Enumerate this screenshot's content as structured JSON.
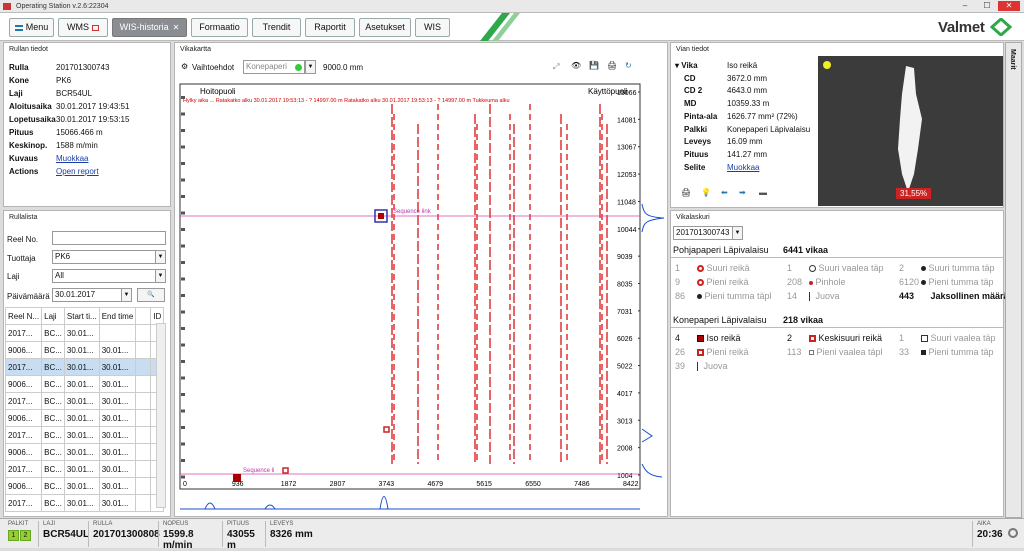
{
  "window": {
    "title": "Operating Station v.2.6:22304"
  },
  "tabs": [
    {
      "label": "Menu"
    },
    {
      "label": "WMS"
    },
    {
      "label": "WIS-historia"
    },
    {
      "label": "Formaatio"
    },
    {
      "label": "Trendit"
    },
    {
      "label": "Raportit"
    },
    {
      "label": "Asetukset"
    },
    {
      "label": "WIS"
    }
  ],
  "brand": {
    "name": "Valmet",
    "color": "#2ea84a"
  },
  "rullan_tiedot": {
    "title": "Rullan tiedot",
    "rows": [
      {
        "k": "Rulla",
        "v": "201701300743"
      },
      {
        "k": "Kone",
        "v": "PK6"
      },
      {
        "k": "Laji",
        "v": "BCR54UL"
      },
      {
        "k": "Aloitusaika",
        "v": "30.01.2017 19:43:51"
      },
      {
        "k": "Lopetusaika",
        "v": "30.01.2017 19:53:15"
      },
      {
        "k": "Pituus",
        "v": "15066.466 m"
      },
      {
        "k": "Keskinop.",
        "v": "1588 m/min"
      },
      {
        "k": "Kuvaus",
        "v": "Muokkaa"
      },
      {
        "k": "Actions",
        "v": "Open report"
      }
    ]
  },
  "rullalista": {
    "title": "Rullalista",
    "reel_label": "Reel No.",
    "reel_value": "",
    "tuottaja_label": "Tuottaja",
    "tuottaja_value": "PK6",
    "laji_label": "Laji",
    "laji_value": "All",
    "date_label": "Päivämäärä",
    "date_value": "30.01.2017",
    "columns": [
      "Reel N...",
      "Laji",
      "Start ti...",
      "End time",
      "",
      "ID"
    ],
    "rows": [
      [
        "2017...",
        "BC...",
        "30.01...",
        "",
        "",
        ""
      ],
      [
        "9006...",
        "BC...",
        "30.01...",
        "30.01...",
        "",
        ""
      ],
      [
        "2017...",
        "BC...",
        "30.01...",
        "30.01...",
        "",
        ""
      ],
      [
        "9006...",
        "BC...",
        "30.01...",
        "30.01...",
        "",
        ""
      ],
      [
        "2017...",
        "BC...",
        "30.01...",
        "30.01...",
        "",
        ""
      ],
      [
        "9006...",
        "BC...",
        "30.01...",
        "30.01...",
        "",
        ""
      ],
      [
        "2017...",
        "BC...",
        "30.01...",
        "30.01...",
        "",
        ""
      ],
      [
        "9006...",
        "BC...",
        "30.01...",
        "30.01...",
        "",
        ""
      ],
      [
        "2017...",
        "BC...",
        "30.01...",
        "30.01...",
        "",
        ""
      ],
      [
        "9006...",
        "BC...",
        "30.01...",
        "30.01...",
        "",
        ""
      ],
      [
        "2017...",
        "BC...",
        "30.01...",
        "30.01...",
        "",
        ""
      ]
    ]
  },
  "vikakartta": {
    "title": "Vikakartta",
    "vaihtoehdot": "Vaihtoehdot",
    "select_value": "Konepaperi",
    "range": "9000.0 mm",
    "corner_left": "Hoitopuoli",
    "corner_right": "Käyttöpuoli",
    "header_text": "Hylky aika ... Ratakatko alku 30.01.2017 19:53:13 - ? 14997.00 m  Ratakatko alku 30.01.2017 19:53:13 - ? 14997.00 m  Tukkeuma alku",
    "seq1": "Sequence link",
    "seq2": "Sequence li",
    "y_ticks": [
      "15066",
      "14081",
      "13067",
      "12053",
      "11048",
      "10044",
      "9039",
      "8035",
      "7031",
      "6026",
      "5022",
      "4017",
      "3013",
      "2008",
      "1004"
    ],
    "x_ticks": [
      "0",
      "936",
      "1872",
      "2807",
      "3743",
      "4679",
      "5615",
      "6550",
      "7486",
      "8422"
    ]
  },
  "vian_tiedot": {
    "title": "Vian tiedot",
    "rows": [
      {
        "k": "Vika",
        "v": "Iso reikä"
      },
      {
        "k": "CD",
        "v": "3672.0 mm"
      },
      {
        "k": "CD 2",
        "v": "4643.0 mm"
      },
      {
        "k": "MD",
        "v": "10359.33 m"
      },
      {
        "k": "Pinta-ala",
        "v": "1626.77 mm² (72%)"
      },
      {
        "k": "Palkki",
        "v": "Konepaperi Läpivalaisu"
      },
      {
        "k": "Leveys",
        "v": "16.09 mm"
      },
      {
        "k": "Pituus",
        "v": "141.27 mm"
      },
      {
        "k": "Selite",
        "v": "Muokkaa"
      }
    ],
    "image_percent": "31,55%"
  },
  "vikalaskuri": {
    "title": "Vikalaskuri",
    "reel": "201701300743",
    "group1": {
      "name": "Pohjapaperi Läpivalaisu",
      "count": "6441 vikaa",
      "rows": [
        [
          {
            "n": "1",
            "t": "Suuri reikä"
          },
          {
            "n": "1",
            "t": "Suuri vaalea täp"
          },
          {
            "n": "2",
            "t": "Suuri tumma täp"
          }
        ],
        [
          {
            "n": "9",
            "t": "Pieni reikä"
          },
          {
            "n": "208",
            "t": "Pinhole"
          },
          {
            "n": "6120",
            "t": "Pieni tumma täp"
          }
        ],
        [
          {
            "n": "86",
            "t": "Pieni tumma täpl"
          },
          {
            "n": "14",
            "t": "Juova"
          },
          {
            "n": "443",
            "t": "Jaksollinen määrä"
          }
        ]
      ]
    },
    "group2": {
      "name": "Konepaperi Läpivalaisu",
      "count": "218 vikaa",
      "rows": [
        [
          {
            "n": "4",
            "t": "Iso reikä"
          },
          {
            "n": "2",
            "t": "Keskisuuri reikä"
          },
          {
            "n": "1",
            "t": "Suuri vaalea täp"
          }
        ],
        [
          {
            "n": "26",
            "t": "Pieni reikä"
          },
          {
            "n": "113",
            "t": "Pieni vaalea täpl"
          },
          {
            "n": "33",
            "t": "Pieni tumma täp"
          }
        ],
        [
          {
            "n": "39",
            "t": "Juova"
          },
          {
            "n": "",
            "t": ""
          },
          {
            "n": "",
            "t": ""
          }
        ]
      ]
    }
  },
  "sidebar_tab": "Maarit",
  "status": {
    "palkit_label": "PALKIT",
    "palkit": [
      "1",
      "2"
    ],
    "laji_label": "LAJI",
    "laji": "BCR54UL",
    "rulla_label": "RULLA",
    "rulla": "201701300808",
    "nopeus_label": "NOPEUS",
    "nopeus": "1599.8 m/min",
    "pituus_label": "PITUUS",
    "pituus": "43055 m",
    "leveys_label": "LEVEYS",
    "leveys": "8326 mm",
    "aika_label": "AIKA",
    "aika": "20:36"
  }
}
